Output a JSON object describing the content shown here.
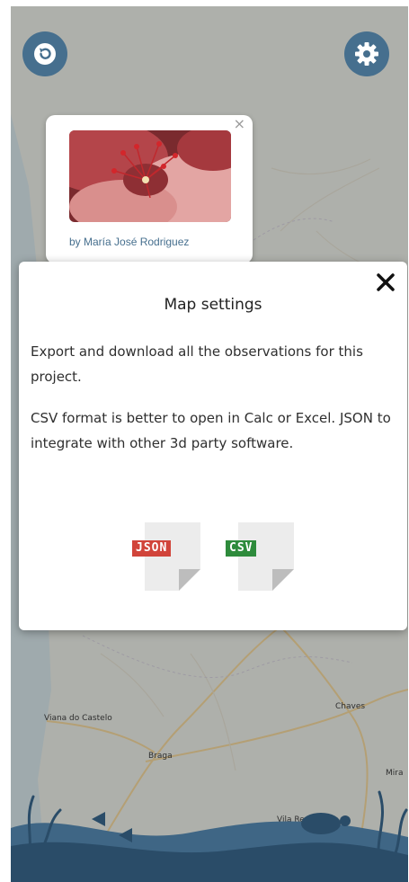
{
  "map": {
    "city_labels": [
      "Viana do Castelo",
      "Braga",
      "Chaves",
      "Vila Real",
      "Mira"
    ]
  },
  "toolbar": {
    "back_icon": "undo-arrow-icon",
    "settings_icon": "gear-icon",
    "button_color": "#466f8e"
  },
  "popup": {
    "close_symbol": "×",
    "photo_icon": "flower-photo",
    "credit": "by María José Rodriguez"
  },
  "modal": {
    "title": "Map settings",
    "close_icon": "close-x-icon",
    "paragraph1": "Export and download all the observations for this project.",
    "paragraph2": "CSV format is better to open in Calc or Excel. JSON to integrate with other 3d party software.",
    "json_label": "JSON",
    "csv_label": "CSV",
    "json_color": "#d1443a",
    "csv_color": "#2e8b3c"
  }
}
